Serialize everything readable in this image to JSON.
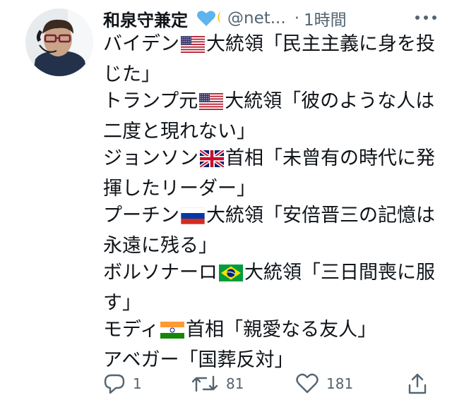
{
  "author": {
    "display_name": "和泉守兼定",
    "handle": "@net...",
    "separator": "·",
    "timestamp": "1時間"
  },
  "tweet": {
    "lines": [
      {
        "pre": "バイデン",
        "flag": "flag-us",
        "post": "大統領「民主主義に身を投"
      },
      {
        "pre": "じた」"
      },
      {
        "pre": "トランプ元",
        "flag": "flag-us",
        "post": "大統領「彼のような人は"
      },
      {
        "pre": "二度と現れない」"
      },
      {
        "pre": "ジョンソン",
        "flag": "flag-uk",
        "post": "首相「未曾有の時代に発"
      },
      {
        "pre": "揮したリーダー」"
      },
      {
        "pre": "プーチン",
        "flag": "flag-ru",
        "post": "大統領「安倍晋三の記憶は"
      },
      {
        "pre": "永遠に残る」"
      },
      {
        "pre": "ボルソナーロ",
        "flag": "flag-br",
        "post": "大統領「三日間喪に服"
      },
      {
        "pre": "す」"
      },
      {
        "pre": "モディ",
        "flag": "flag-in",
        "post": "首相「親愛なる友人」"
      },
      {
        "pre": "アベガー「国葬反対」"
      }
    ]
  },
  "actions": {
    "reply_count": "1",
    "retweet_count": "81",
    "like_count": "181"
  },
  "icons": {
    "reply": "reply-icon",
    "retweet": "retweet-icon",
    "like": "like-icon",
    "share": "share-icon",
    "more": "more-icon",
    "handle_decoration": "heart-moon-icon"
  },
  "colors": {
    "text": "#0f1419",
    "secondary": "#536471",
    "heart": "#5fb3ef",
    "moon": "#f4c20d"
  }
}
